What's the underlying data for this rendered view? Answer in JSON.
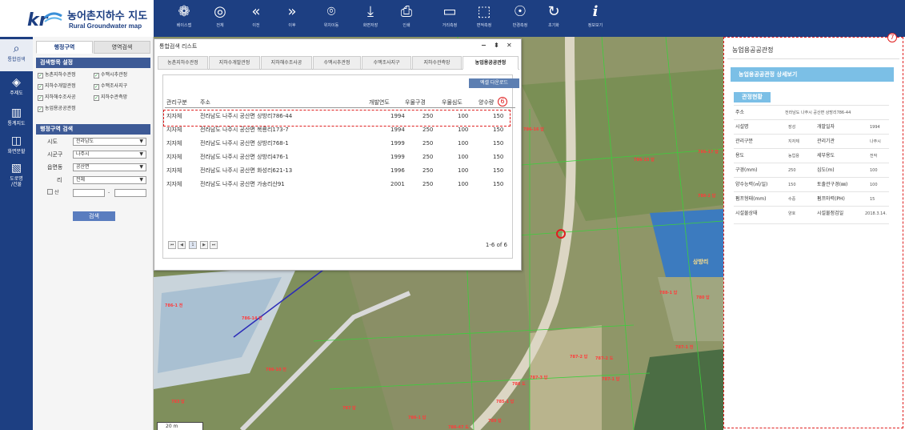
{
  "app": {
    "title_ko": "농어촌지하수 지도",
    "title_en": "Rural Groundwater map",
    "logo_text": "kr"
  },
  "toolbar": [
    {
      "label": "베이스맵",
      "icon": "basemap-icon"
    },
    {
      "label": "전체",
      "icon": "compass-icon"
    },
    {
      "label": "이전",
      "icon": "back-icon"
    },
    {
      "label": "이후",
      "icon": "forward-icon"
    },
    {
      "label": "위치이동",
      "icon": "location-icon"
    },
    {
      "label": "화면저장",
      "icon": "save-icon"
    },
    {
      "label": "인쇄",
      "icon": "print-icon"
    },
    {
      "label": "거리측정",
      "icon": "ruler-icon"
    },
    {
      "label": "면적측정",
      "icon": "area-icon"
    },
    {
      "label": "반경측정",
      "icon": "radius-icon"
    },
    {
      "label": "초기화",
      "icon": "refresh-icon"
    },
    {
      "label": "정보보기",
      "icon": "info-icon"
    }
  ],
  "rail": [
    {
      "label": "통합검색",
      "icon": "search-icon"
    },
    {
      "label": "주제도",
      "icon": "layers-icon"
    },
    {
      "label": "통계지도",
      "icon": "bar-chart-icon"
    },
    {
      "label": "화면분할",
      "icon": "split-screen-icon"
    },
    {
      "label": "도로명\n/건물",
      "icon": "map-icon"
    }
  ],
  "search_panel": {
    "tabs": [
      "행정구역",
      "영역검색"
    ],
    "items_title": "검색항목 설정",
    "checkboxes": [
      {
        "label": "농촌지하수관정",
        "checked": true
      },
      {
        "label": "수맥시추관정",
        "checked": true
      },
      {
        "label": "지하수개발관정",
        "checked": true
      },
      {
        "label": "수맥조사지구",
        "checked": true
      },
      {
        "label": "지하해수조사공",
        "checked": true
      },
      {
        "label": "지하수관측망",
        "checked": true
      },
      {
        "label": "농업용공공관정",
        "checked": true
      }
    ],
    "admin_title": "행정구역 검색",
    "fields": [
      {
        "label": "시도",
        "value": "전라남도"
      },
      {
        "label": "시군구",
        "value": "나주시"
      },
      {
        "label": "읍면동",
        "value": "공산면"
      },
      {
        "label": "리",
        "value": "전체"
      }
    ],
    "mountain_label": "산",
    "dash": "-",
    "search_button": "검색"
  },
  "result_window": {
    "title": "통합검색 리스트",
    "minimize": "−",
    "pin": "⬍",
    "close": "✕",
    "tabs": [
      "농촌지하수관정",
      "지하수개발관정",
      "지하해수조사공",
      "수맥시추관정",
      "수맥조사지구",
      "지하수관측망",
      "농업용공공관정"
    ],
    "active_tab": 6,
    "excel_button": "엑셀 다운로드",
    "columns": [
      "관리구분",
      "주소",
      "개발연도",
      "우물구경",
      "우물심도",
      "양수량"
    ],
    "rows": [
      [
        "지자체",
        "전라남도 나주시 공산면 상방리786-44",
        "1994",
        "250",
        "100",
        "150"
      ],
      [
        "지자체",
        "전라남도 나주시 공산면 복룡리173-7",
        "1994",
        "250",
        "100",
        "150"
      ],
      [
        "지자체",
        "전라남도 나주시 공산면 상방리768-1",
        "1999",
        "250",
        "100",
        "150"
      ],
      [
        "지자체",
        "전라남도 나주시 공산면 상방리476-1",
        "1999",
        "250",
        "100",
        "150"
      ],
      [
        "지자체",
        "전라남도 나주시 공산면 화성리621-13",
        "1996",
        "250",
        "100",
        "150"
      ],
      [
        "지자체",
        "전라남도 나주시 공산면 가송리산91",
        "2001",
        "250",
        "100",
        "150"
      ]
    ],
    "annotation_num": "6",
    "pager_first": "⏮",
    "pager_prev": "◀",
    "pager_page": "1",
    "pager_next": "▶",
    "pager_last": "⏭",
    "pager_count": "1-6 of 6"
  },
  "map": {
    "scale": "20 m",
    "marker_label": "상방리",
    "parcels": [
      "786-16 답",
      "786-15 답",
      "786-17 답",
      "786-1 전",
      "786-14 답",
      "786-10 전",
      "787 답",
      "783 답",
      "786-1 답",
      "786-47 도",
      "785-1 답",
      "786 도",
      "787-3 답",
      "787-2 답",
      "787-1 답",
      "787-2 도",
      "789 답",
      "788-1 답",
      "780 답",
      "787-1 전",
      "786-2 답"
    ]
  },
  "detail_panel": {
    "title": "농업용공공관정",
    "head": "농업용공공관정 상세보기",
    "sub": "관정현황",
    "address_label": "주소",
    "address_value": "전라남도 나주시 공산면 상방리786-44",
    "annotation_num": "7",
    "rows": [
      [
        "시설명",
        "장성",
        "개발일자",
        "1994"
      ],
      [
        "관리구분",
        "지자체",
        "관리기관",
        "나주시"
      ],
      [
        "용도",
        "농업용",
        "세부용도",
        "전작"
      ],
      [
        "구경(mm)",
        "250",
        "심도(m)",
        "100"
      ],
      [
        "양수능력(㎥/일)",
        "150",
        "토출관구경(㎜)",
        "100"
      ],
      [
        "펌프형태(mm)",
        "수중",
        "펌프마력(PH)",
        "15"
      ],
      [
        "시설물상태",
        "양호",
        "시설물점검일",
        "2018.3.14."
      ]
    ]
  },
  "colors": {
    "navy": "#1d3f82",
    "sky": "#7bbfe6",
    "annotation_red": "#e01f1f",
    "button_blue": "#5d7fb2"
  }
}
